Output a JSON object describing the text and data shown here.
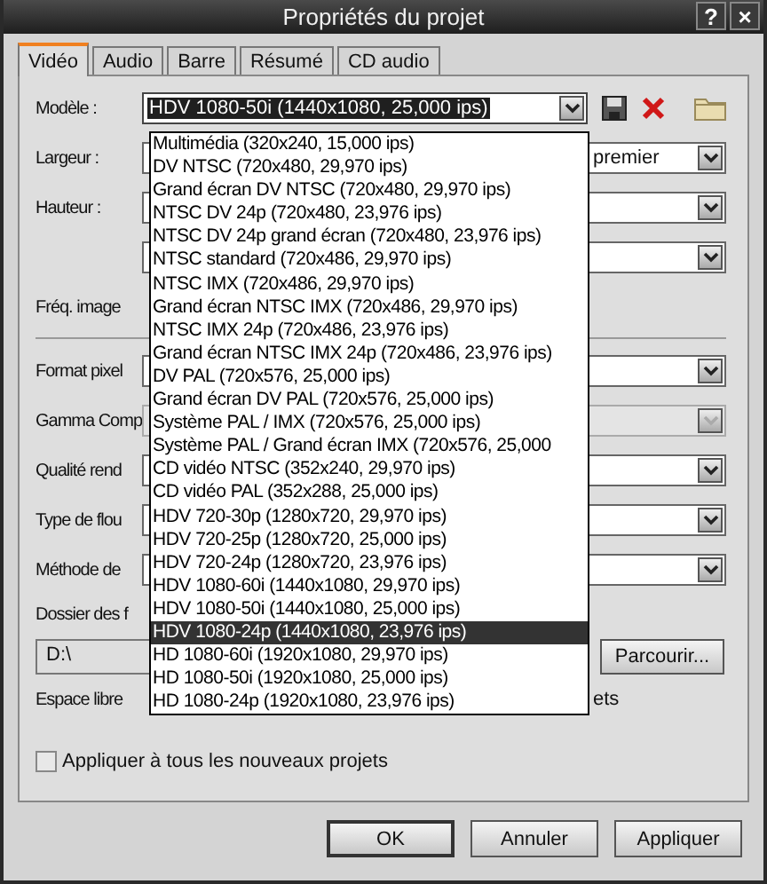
{
  "window": {
    "title": "Propriétés du projet",
    "help": "?",
    "close": "×"
  },
  "tabs": [
    {
      "label": "Vidéo",
      "selected": true
    },
    {
      "label": "Audio",
      "selected": false
    },
    {
      "label": "Barre",
      "selected": false
    },
    {
      "label": "Résumé",
      "selected": false
    },
    {
      "label": "CD audio",
      "selected": false
    }
  ],
  "model": {
    "label": "Modèle :",
    "value": "HDV 1080-50i (1440x1080, 25,000 ips)"
  },
  "fields": [
    {
      "kind": "combo",
      "label": "Largeur :",
      "value": "premier",
      "disabled": false
    },
    {
      "kind": "combo",
      "label": "Hauteur :",
      "disabled": false
    },
    {
      "kind": "combo",
      "disabled": false
    },
    {
      "kind": "label",
      "label": "Fréq. image"
    },
    {
      "kind": "divider"
    },
    {
      "kind": "combo",
      "label": "Format pixel",
      "disabled": false
    },
    {
      "kind": "combo",
      "label": "Gamma Comp",
      "disabled": true
    },
    {
      "kind": "combo",
      "label": "Qualité rend",
      "disabled": false
    },
    {
      "kind": "combo",
      "label": "Type de flou",
      "disabled": false
    },
    {
      "kind": "combo",
      "label": "Méthode de",
      "disabled": false
    }
  ],
  "folder": {
    "label": "Dossier des f",
    "path": "D:\\",
    "browse": "Parcourir..."
  },
  "free_space": {
    "label": "Espace libre",
    "tail": "ets"
  },
  "apply_all": {
    "label": "Appliquer à tous les nouveaux projets",
    "checked": false
  },
  "buttons": [
    "OK",
    "Annuler",
    "Appliquer"
  ],
  "dropdown": [
    {
      "label": "Multimédia (320x240, 15,000 ips)",
      "selected": false
    },
    {
      "label": "DV NTSC (720x480, 29,970 ips)",
      "selected": false
    },
    {
      "label": "Grand écran DV NTSC (720x480, 29,970 ips)",
      "selected": false
    },
    {
      "label": "NTSC DV 24p (720x480, 23,976 ips)",
      "selected": false
    },
    {
      "label": "NTSC DV 24p grand écran (720x480, 23,976 ips)",
      "selected": false
    },
    {
      "label": "NTSC standard (720x486, 29,970 ips)",
      "selected": false
    },
    {
      "label": "NTSC IMX (720x486, 29,970 ips)",
      "selected": false
    },
    {
      "label": "Grand écran NTSC IMX (720x486, 29,970 ips)",
      "selected": false
    },
    {
      "label": "NTSC IMX 24p (720x486, 23,976 ips)",
      "selected": false
    },
    {
      "label": "Grand écran NTSC IMX 24p (720x486, 23,976 ips)",
      "selected": false
    },
    {
      "label": "DV PAL (720x576, 25,000 ips)",
      "selected": false
    },
    {
      "label": "Grand écran DV PAL (720x576, 25,000 ips)",
      "selected": false
    },
    {
      "label": "Système PAL / IMX (720x576, 25,000 ips)",
      "selected": false
    },
    {
      "label": "Système PAL / Grand écran IMX (720x576, 25,000",
      "selected": false
    },
    {
      "label": "CD vidéo NTSC (352x240, 29,970 ips)",
      "selected": false
    },
    {
      "label": "CD vidéo PAL (352x288, 25,000 ips)",
      "selected": false
    },
    {
      "label": "HDV 720-30p (1280x720, 29,970 ips)",
      "selected": false
    },
    {
      "label": "HDV 720-25p (1280x720, 25,000 ips)",
      "selected": false
    },
    {
      "label": "HDV 720-24p (1280x720, 23,976 ips)",
      "selected": false
    },
    {
      "label": "HDV 1080-60i (1440x1080, 29,970 ips)",
      "selected": false
    },
    {
      "label": "HDV 1080-50i (1440x1080, 25,000 ips)",
      "selected": false
    },
    {
      "label": "HDV 1080-24p (1440x1080, 23,976 ips)",
      "selected": true
    },
    {
      "label": "HD 1080-60i (1920x1080, 29,970 ips)",
      "selected": false
    },
    {
      "label": "HD 1080-50i (1920x1080, 25,000 ips)",
      "selected": false
    },
    {
      "label": "HD 1080-24p (1920x1080, 23,976 ips)",
      "selected": false
    }
  ]
}
